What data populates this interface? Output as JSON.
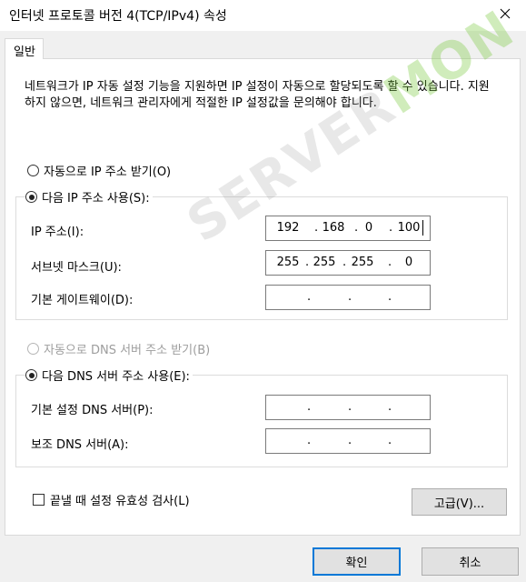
{
  "window": {
    "title": "인터넷 프로토콜 버전 4(TCP/IPv4) 속성"
  },
  "tabs": [
    {
      "label": "일반"
    }
  ],
  "description": "네트워크가 IP 자동 설정 기능을 지원하면 IP 설정이 자동으로 할당되도록 할 수 있습니다. 지원하지 않으면, 네트워크 관리자에게 적절한 IP 설정값을 문의해야 합니다.",
  "ip_section": {
    "auto_label": "자동으로 IP 주소 받기(O)",
    "manual_label": "다음 IP 주소 사용(S):",
    "selected": "manual",
    "fields": {
      "ip_address": {
        "label": "IP 주소(I):",
        "octets": [
          "192",
          "168",
          "0",
          "100"
        ]
      },
      "subnet_mask": {
        "label": "서브넷 마스크(U):",
        "octets": [
          "255",
          "255",
          "255",
          "0"
        ]
      },
      "default_gateway": {
        "label": "기본 게이트웨이(D):",
        "octets": [
          "",
          "",
          "",
          ""
        ]
      }
    }
  },
  "dns_section": {
    "auto_label": "자동으로 DNS 서버 주소 받기(B)",
    "manual_label": "다음 DNS 서버 주소 사용(E):",
    "selected": "manual",
    "fields": {
      "preferred": {
        "label": "기본 설정 DNS 서버(P):",
        "octets": [
          "",
          "",
          "",
          ""
        ]
      },
      "alternate": {
        "label": "보조 DNS 서버(A):",
        "octets": [
          "",
          "",
          "",
          ""
        ]
      }
    }
  },
  "validate_on_exit": {
    "label": "끝낼 때 설정 유효성 검사(L)",
    "checked": false
  },
  "buttons": {
    "advanced": "고급(V)...",
    "ok": "확인",
    "cancel": "취소"
  },
  "watermark": {
    "text_main": "SERVER",
    "text_accent": "MON"
  },
  "colors": {
    "focus_border": "#0078d7",
    "window_bg": "#f0f0f0",
    "panel_bg": "#ffffff",
    "disabled_text": "#9d9d9d"
  }
}
